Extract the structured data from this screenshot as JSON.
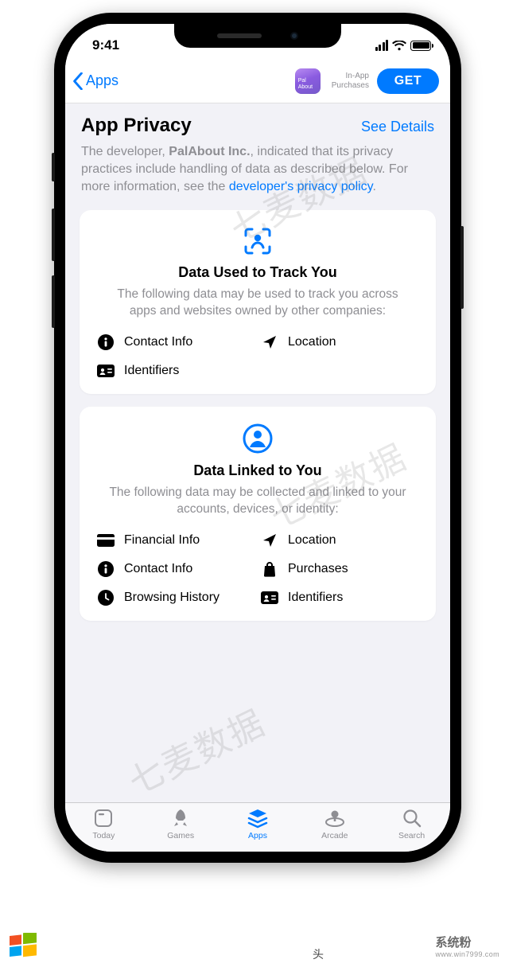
{
  "status": {
    "time": "9:41"
  },
  "nav": {
    "back_label": "Apps",
    "app_icon_label": "Pal\nAbout",
    "in_app_line1": "In-App",
    "in_app_line2": "Purchases",
    "get_label": "GET"
  },
  "privacy": {
    "title": "App Privacy",
    "see_details": "See Details",
    "intro_prefix": "The developer, ",
    "developer": "PalAbout Inc.",
    "intro_mid": ", indicated that its privacy practices include handling of data as described below. For more information, see the ",
    "intro_link": "developer's privacy policy",
    "intro_suffix": "."
  },
  "cards": {
    "track": {
      "title": "Data Used to Track You",
      "desc": "The following data may be used to track you across apps and websites owned by other companies:",
      "items": [
        "Contact Info",
        "Location",
        "Identifiers"
      ]
    },
    "linked": {
      "title": "Data Linked to You",
      "desc": "The following data may be collected and linked to your accounts, devices, or identity:",
      "items": [
        "Financial Info",
        "Location",
        "Contact Info",
        "Purchases",
        "Browsing History",
        "Identifiers"
      ]
    }
  },
  "tabs": {
    "today": "Today",
    "games": "Games",
    "apps": "Apps",
    "arcade": "Arcade",
    "search": "Search"
  },
  "watermark": "七麦数据",
  "footer": {
    "brand": "系统粉",
    "url": "www.win7999.com"
  },
  "toutiao_partial": "头"
}
